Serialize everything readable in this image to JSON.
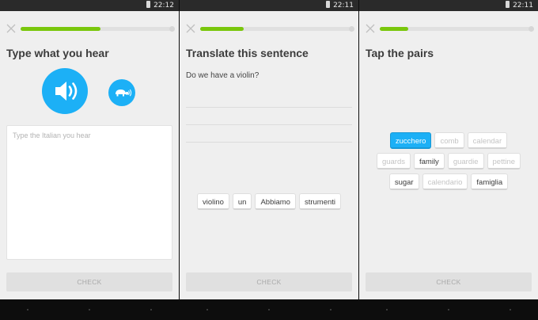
{
  "screens": [
    {
      "status_time": "22:12",
      "progress": 0.53,
      "title": "Type what you hear",
      "audio_button_icon": "speaker-icon",
      "slow_audio_button_icon": "turtle-icon",
      "input_placeholder": "Type the Italian you hear",
      "input_value": "",
      "check_label": "CHECK"
    },
    {
      "status_time": "22:11",
      "progress": 0.29,
      "title": "Translate this sentence",
      "prompt": "Do we have a violin?",
      "word_bank": [
        "violino",
        "un",
        "Abbiamo",
        "strumenti"
      ],
      "check_label": "CHECK"
    },
    {
      "status_time": "22:11",
      "progress": 0.19,
      "title": "Tap the pairs",
      "pairs": [
        [
          {
            "text": "zucchero",
            "state": "selected"
          },
          {
            "text": "comb",
            "state": "dim"
          },
          {
            "text": "calendar",
            "state": "dim"
          }
        ],
        [
          {
            "text": "guards",
            "state": "dim"
          },
          {
            "text": "family",
            "state": "normal"
          },
          {
            "text": "guardie",
            "state": "dim"
          },
          {
            "text": "pettine",
            "state": "dim"
          }
        ],
        [
          {
            "text": "sugar",
            "state": "normal"
          },
          {
            "text": "calendario",
            "state": "dim"
          },
          {
            "text": "famiglia",
            "state": "normal"
          }
        ]
      ],
      "check_label": "CHECK"
    }
  ],
  "colors": {
    "accent_blue": "#1cb0f6",
    "progress_green": "#7ac70c",
    "background": "#efefef"
  }
}
